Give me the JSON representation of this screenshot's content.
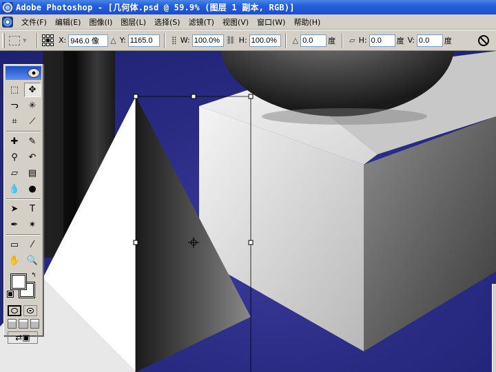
{
  "window": {
    "title": "Adobe Photoshop - [几何体.psd @ 59.9% (图层 1 副本, RGB)]"
  },
  "menu": {
    "items": [
      {
        "label": "文件(F)"
      },
      {
        "label": "编辑(E)"
      },
      {
        "label": "图像(I)"
      },
      {
        "label": "图层(L)"
      },
      {
        "label": "选择(S)"
      },
      {
        "label": "滤镜(T)"
      },
      {
        "label": "视图(V)"
      },
      {
        "label": "窗口(W)"
      },
      {
        "label": "帮助(H)"
      }
    ]
  },
  "options": {
    "x_label": "X:",
    "x_value": "946.0 像",
    "y_label": "Y:",
    "y_value": "1165.0",
    "w_label": "W:",
    "w_value": "100.0%",
    "h_label": "H:",
    "h_value": "100.0%",
    "angle_value": "0.0",
    "angle_unit": "度",
    "hskew_label": "H:",
    "hskew_value": "0.0",
    "hskew_unit": "度",
    "vskew_label": "V:",
    "vskew_value": "0.0",
    "vskew_unit": "度"
  },
  "toolbox": {
    "tools": [
      {
        "name": "marquee-tool",
        "glyph": "⬚"
      },
      {
        "name": "move-tool",
        "glyph": "✥"
      },
      {
        "name": "lasso-tool",
        "glyph": "ᓓ"
      },
      {
        "name": "magic-wand-tool",
        "glyph": "✳"
      },
      {
        "name": "crop-tool",
        "glyph": "⌗"
      },
      {
        "name": "slice-tool",
        "glyph": "⟋"
      },
      {
        "name": "healing-brush-tool",
        "glyph": "✚"
      },
      {
        "name": "brush-tool",
        "glyph": "✎"
      },
      {
        "name": "clone-stamp-tool",
        "glyph": "⚲"
      },
      {
        "name": "history-brush-tool",
        "glyph": "↶"
      },
      {
        "name": "eraser-tool",
        "glyph": "▱"
      },
      {
        "name": "gradient-tool",
        "glyph": "▤"
      },
      {
        "name": "blur-tool",
        "glyph": "💧"
      },
      {
        "name": "dodge-tool",
        "glyph": "●"
      },
      {
        "name": "path-selection-tool",
        "glyph": "➤"
      },
      {
        "name": "type-tool",
        "glyph": "T"
      },
      {
        "name": "pen-tool",
        "glyph": "✒"
      },
      {
        "name": "shape-tool",
        "glyph": "✶"
      },
      {
        "name": "notes-tool",
        "glyph": "▭"
      },
      {
        "name": "eyedropper-tool",
        "glyph": "⁄"
      },
      {
        "name": "hand-tool",
        "glyph": "✋"
      },
      {
        "name": "zoom-tool",
        "glyph": "🔍"
      }
    ]
  },
  "colors": {
    "foreground": "#ffffff",
    "background": "#ffffff",
    "canvas_background": "#2a2c85",
    "titlebar": "#245edb"
  }
}
